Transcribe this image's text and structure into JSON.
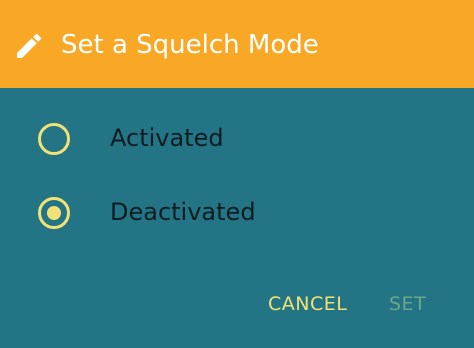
{
  "dialog": {
    "title": "Set a Squelch Mode",
    "title_icon": "pencil-icon",
    "options": [
      {
        "label": "Activated",
        "selected": false
      },
      {
        "label": "Deactivated",
        "selected": true
      }
    ],
    "buttons": {
      "cancel_label": "CANCEL",
      "set_label": "SET",
      "set_enabled": false
    }
  },
  "colors": {
    "header_bg": "#F9A825",
    "body_bg": "#237585",
    "accent": "#F2E276",
    "disabled_text": "#6BA88A",
    "label_text": "#0F1D22"
  }
}
